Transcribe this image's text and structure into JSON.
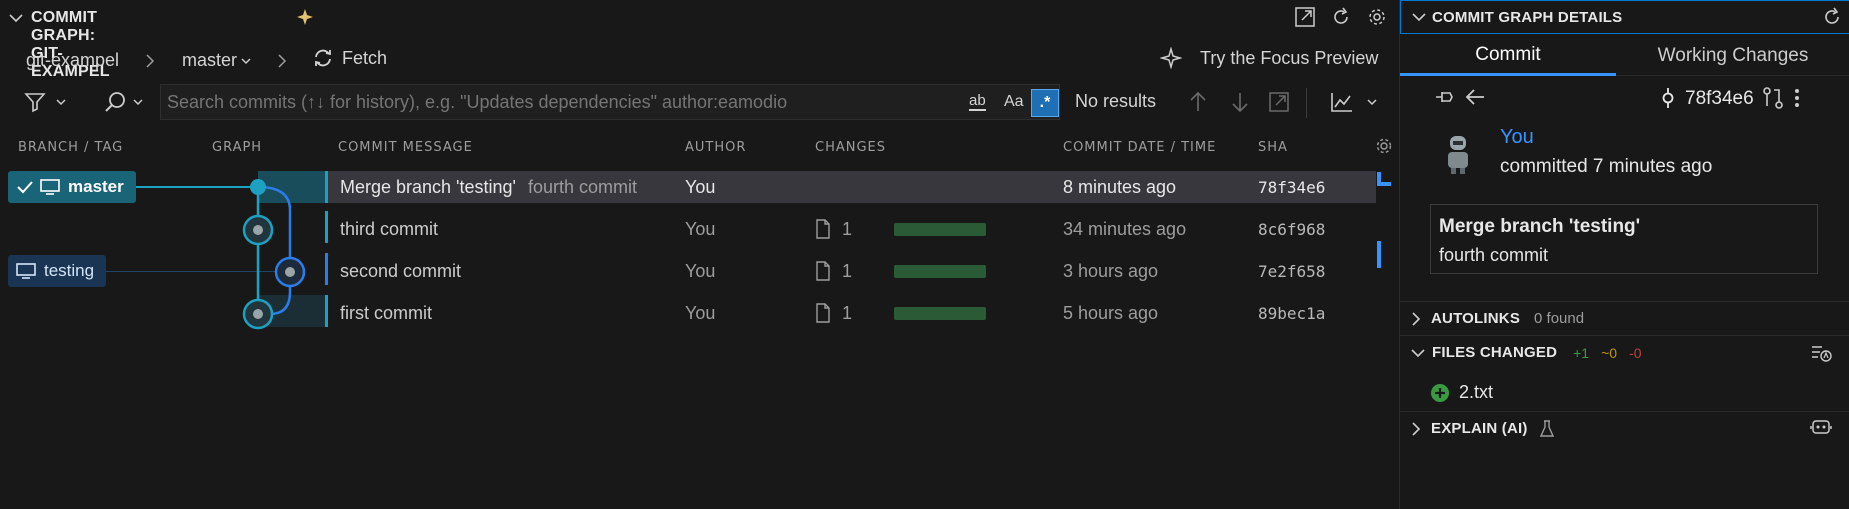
{
  "graph_panel": {
    "title": "COMMIT GRAPH: GIT-EXAMPEL",
    "breadcrumb": {
      "repo": "git-exampel",
      "branch": "master",
      "fetch": "Fetch"
    },
    "focus_preview": "Try the Focus Preview",
    "search": {
      "placeholder": "Search commits (↑↓ for history), e.g. \"Updates dependencies\" author:eamodio",
      "opt_word": "ab",
      "opt_case": "Aa",
      "opt_regex": ".*",
      "results": "No results"
    },
    "columns": {
      "branch": "BRANCH / TAG",
      "graph": "GRAPH",
      "message": "COMMIT MESSAGE",
      "author": "AUTHOR",
      "changes": "CHANGES",
      "date": "COMMIT DATE / TIME",
      "sha": "SHA"
    },
    "branches": {
      "master": "master",
      "testing": "testing"
    },
    "rows": [
      {
        "message": "Merge branch 'testing'",
        "message_extra": "fourth commit",
        "author": "You",
        "changes": "",
        "change_amount": 0,
        "date": "8 minutes ago",
        "sha": "78f34e6"
      },
      {
        "message": "third commit",
        "message_extra": "",
        "author": "You",
        "changes": "1",
        "change_amount": 1,
        "date": "34 minutes ago",
        "sha": "8c6f968"
      },
      {
        "message": "second commit",
        "message_extra": "",
        "author": "You",
        "changes": "1",
        "change_amount": 1,
        "date": "3 hours ago",
        "sha": "7e2f658"
      },
      {
        "message": "first commit",
        "message_extra": "",
        "author": "You",
        "changes": "1",
        "change_amount": 1,
        "date": "5 hours ago",
        "sha": "89bec1a"
      }
    ]
  },
  "details_panel": {
    "title": "COMMIT GRAPH DETAILS",
    "tabs": {
      "commit": "Commit",
      "working": "Working Changes"
    },
    "sha": "78f34e6",
    "author": "You",
    "committed": "committed 7 minutes ago",
    "message_title": "Merge branch 'testing'",
    "message_body": "fourth commit",
    "autolinks": {
      "label": "AUTOLINKS",
      "count": "0 found"
    },
    "files_changed": {
      "label": "FILES CHANGED",
      "added": "+1",
      "modified": "~0",
      "deleted": "-0"
    },
    "files": [
      {
        "name": "2.txt"
      }
    ],
    "explain": {
      "label": "EXPLAIN (AI)"
    }
  },
  "colors": {
    "accent": "#1da1c0",
    "branch2": "#2b7de9",
    "added": "#3a9a42",
    "modified_text": "#b89500",
    "deleted_text": "#c0403a",
    "tab_underline": "#3794ff",
    "selected_row": "#37373d"
  }
}
